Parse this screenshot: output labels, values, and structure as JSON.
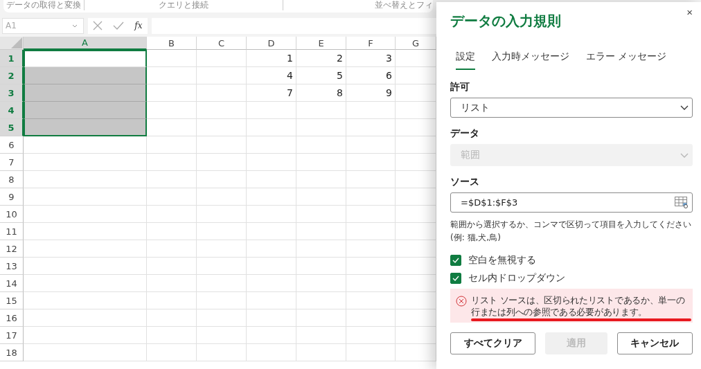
{
  "ribbon": {
    "groups": [
      "データの取得と変換",
      "クエリと接続",
      "並べ替えとフィ"
    ]
  },
  "formula_bar": {
    "name_box": "A1",
    "fx": "fx"
  },
  "sheet": {
    "columns": [
      {
        "label": "A",
        "selected": true
      },
      {
        "label": "B",
        "selected": false
      },
      {
        "label": "C",
        "selected": false
      },
      {
        "label": "D",
        "selected": false
      },
      {
        "label": "E",
        "selected": false
      },
      {
        "label": "F",
        "selected": false
      },
      {
        "label": "G",
        "selected": false
      }
    ],
    "rows": [
      {
        "label": "1",
        "selected": true,
        "cells": [
          null,
          null,
          null,
          "1",
          "2",
          "3",
          null
        ]
      },
      {
        "label": "2",
        "selected": true,
        "cells": [
          null,
          null,
          null,
          "4",
          "5",
          "6",
          null
        ]
      },
      {
        "label": "3",
        "selected": true,
        "cells": [
          null,
          null,
          null,
          "7",
          "8",
          "9",
          null
        ]
      },
      {
        "label": "4",
        "selected": true
      },
      {
        "label": "5",
        "selected": true
      },
      {
        "label": "6",
        "selected": false
      },
      {
        "label": "7",
        "selected": false
      },
      {
        "label": "8",
        "selected": false
      },
      {
        "label": "9",
        "selected": false
      },
      {
        "label": "10",
        "selected": false
      },
      {
        "label": "11",
        "selected": false
      },
      {
        "label": "12",
        "selected": false
      },
      {
        "label": "13",
        "selected": false
      },
      {
        "label": "14",
        "selected": false
      },
      {
        "label": "15",
        "selected": false
      },
      {
        "label": "16",
        "selected": false
      },
      {
        "label": "17",
        "selected": false
      },
      {
        "label": "18",
        "selected": false
      }
    ]
  },
  "panel": {
    "title": "データの入力規則",
    "close": "×",
    "tabs": [
      {
        "label": "設定",
        "selected": true
      },
      {
        "label": "入力時メッセージ",
        "selected": false
      },
      {
        "label": "エラー メッセージ",
        "selected": false
      }
    ],
    "allow": {
      "label": "許可",
      "value": "リスト",
      "disabled": false
    },
    "data": {
      "label": "データ",
      "value": "範囲",
      "disabled": true
    },
    "source": {
      "label": "ソース",
      "value": "=$D$1:$F$3"
    },
    "help": [
      "範囲から選択するか、コンマで区切って項目を入力してください",
      "(例: 猫,犬,鳥)"
    ],
    "checkboxes": [
      {
        "label": "空白を無視する",
        "checked": true
      },
      {
        "label": "セル内ドロップダウン",
        "checked": true
      }
    ],
    "error": {
      "message": "リスト ソースは、区切られたリストであるか、単一の行または列への参照である必要があります。",
      "underlined": true
    },
    "buttons": [
      {
        "label": "すべてクリア",
        "disabled": false
      },
      {
        "label": "適用",
        "disabled": true
      },
      {
        "label": "キャンセル",
        "disabled": false
      }
    ]
  }
}
